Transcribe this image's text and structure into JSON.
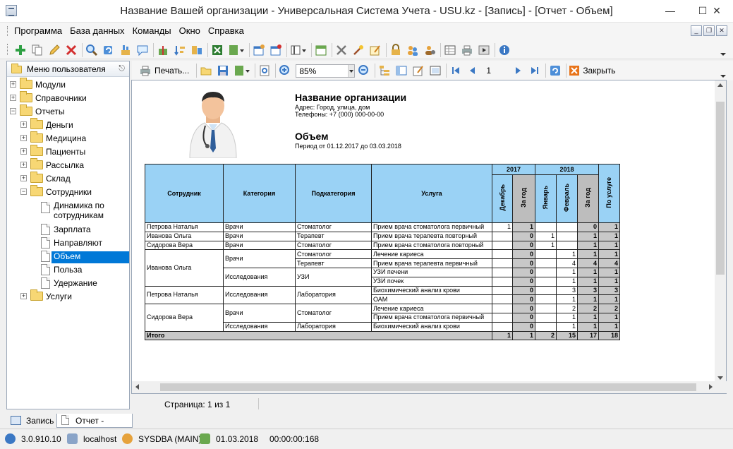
{
  "window": {
    "title": "Название Вашей организации - Универсальная Система Учета - USU.kz - [Запись] - [Отчет - Объем]"
  },
  "menu": [
    "Программа",
    "База данных",
    "Команды",
    "Окно",
    "Справка"
  ],
  "left_panel": {
    "title": "Меню пользователя",
    "items": [
      {
        "label": "Модули",
        "expanded": false
      },
      {
        "label": "Справочники",
        "expanded": false
      },
      {
        "label": "Отчеты",
        "expanded": true
      },
      {
        "label": "Деньги",
        "expanded": false
      },
      {
        "label": "Медицина",
        "expanded": false
      },
      {
        "label": "Пациенты",
        "expanded": false
      },
      {
        "label": "Рассылка",
        "expanded": false
      },
      {
        "label": "Склад",
        "expanded": false
      },
      {
        "label": "Сотрудники",
        "expanded": true
      },
      {
        "label": "Динамика по сотрудникам"
      },
      {
        "label": "Зарплата"
      },
      {
        "label": "Направляют"
      },
      {
        "label": "Объем",
        "selected": true
      },
      {
        "label": "Польза"
      },
      {
        "label": "Удержание"
      },
      {
        "label": "Услуги",
        "expanded": false
      }
    ]
  },
  "report_toolbar": {
    "print_label": "Печать...",
    "zoom": "85%",
    "page_number": "1",
    "close_label": "Закрыть"
  },
  "report": {
    "org_name": "Название организации",
    "address": "Адрес: Город, улица, дом",
    "phones": "Телефоны: +7 (000) 000-00-00",
    "report_title": "Объем",
    "period": "Период от 01.12.2017 до 03.03.2018",
    "headers": {
      "employee": "Сотрудник",
      "category": "Категория",
      "subcategory": "Подкатегория",
      "service": "Услуга",
      "year2017": "2017",
      "year2018": "2018",
      "by_service": "По услуге",
      "dec": "Декабрь",
      "total_period": "За год",
      "jan": "Январь",
      "feb": "Февраль"
    },
    "rows": [
      {
        "employee": "Петрова Наталья",
        "category": "Врачи",
        "subcategory": "Стоматолог",
        "service": "Прием врача стоматолога первичный",
        "dec": "1",
        "t2017": "1",
        "jan": "",
        "feb": "",
        "t2018": "0",
        "total": "1"
      },
      {
        "employee": "Иванова Ольга",
        "category": "Врачи",
        "subcategory": "Терапевт",
        "service": "Прием врача терапевта повторный",
        "dec": "",
        "t2017": "0",
        "jan": "1",
        "feb": "",
        "t2018": "1",
        "total": "1"
      },
      {
        "employee": "Сидорова Вера",
        "category": "Врачи",
        "subcategory": "Стоматолог",
        "service": "Прием врача стоматолога повторный",
        "dec": "",
        "t2017": "0",
        "jan": "1",
        "feb": "",
        "t2018": "1",
        "total": "1"
      },
      {
        "employee": "Иванова Ольга",
        "category": "Врачи",
        "subcategory": "Стоматолог",
        "service": "Лечение кариеса",
        "dec": "",
        "t2017": "0",
        "jan": "",
        "feb": "1",
        "t2018": "1",
        "total": "1"
      },
      {
        "employee": "",
        "category": "",
        "subcategory": "Терапевт",
        "service": "Прием врача терапевта первичный",
        "dec": "",
        "t2017": "0",
        "jan": "",
        "feb": "4",
        "t2018": "4",
        "total": "4"
      },
      {
        "employee": "",
        "category": "Исследования",
        "subcategory": "УЗИ",
        "service": "УЗИ печени",
        "dec": "",
        "t2017": "0",
        "jan": "",
        "feb": "1",
        "t2018": "1",
        "total": "1"
      },
      {
        "employee": "",
        "category": "",
        "subcategory": "",
        "service": "УЗИ почек",
        "dec": "",
        "t2017": "0",
        "jan": "",
        "feb": "1",
        "t2018": "1",
        "total": "1"
      },
      {
        "employee": "Петрова Наталья",
        "category": "Исследования",
        "subcategory": "Лаборатория",
        "service": "Биохимический анализ крови",
        "dec": "",
        "t2017": "0",
        "jan": "",
        "feb": "3",
        "t2018": "3",
        "total": "3"
      },
      {
        "employee": "",
        "category": "",
        "subcategory": "",
        "service": "ОАМ",
        "dec": "",
        "t2017": "0",
        "jan": "",
        "feb": "1",
        "t2018": "1",
        "total": "1"
      },
      {
        "employee": "Сидорова Вера",
        "category": "Врачи",
        "subcategory": "Стоматолог",
        "service": "Лечение кариеса",
        "dec": "",
        "t2017": "0",
        "jan": "",
        "feb": "2",
        "t2018": "2",
        "total": "2"
      },
      {
        "employee": "",
        "category": "",
        "subcategory": "",
        "service": "Прием врача стоматолога первичный",
        "dec": "",
        "t2017": "0",
        "jan": "",
        "feb": "1",
        "t2018": "1",
        "total": "1"
      },
      {
        "employee": "",
        "category": "Исследования",
        "subcategory": "Лаборатория",
        "service": "Биохимический анализ крови",
        "dec": "",
        "t2017": "0",
        "jan": "",
        "feb": "1",
        "t2018": "1",
        "total": "1"
      }
    ],
    "total": {
      "label": "Итого",
      "dec": "1",
      "t2017": "1",
      "jan": "2",
      "feb": "15",
      "t2018": "17",
      "total": "18"
    }
  },
  "page_status": "Страница: 1 из 1",
  "tabs": [
    {
      "label": "Запись",
      "active": false
    },
    {
      "label": "Отчет - Объем",
      "active": true
    }
  ],
  "status": {
    "version": "3.0.910.10",
    "host": "localhost",
    "user": "SYSDBA (MAIN)",
    "date": "01.03.2018",
    "time": "00:00:00:168"
  },
  "colors": {
    "header_blue": "#9ad2f5",
    "selection": "#0078d7",
    "total_gray": "#c8c8c8"
  }
}
